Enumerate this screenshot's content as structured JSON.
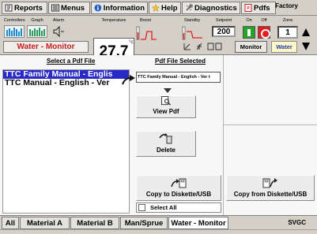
{
  "menu": {
    "items": [
      {
        "label": "Reports",
        "icon": "reports-icon"
      },
      {
        "label": "Menus",
        "icon": "menus-icon"
      },
      {
        "label": "Information",
        "icon": "information-icon"
      },
      {
        "label": "Help",
        "icon": "help-icon"
      },
      {
        "label": "Diagnostics",
        "icon": "diagnostics-icon"
      },
      {
        "label": "Pdfs",
        "icon": "pdf-icon"
      }
    ],
    "user_level": "Factory"
  },
  "controls": {
    "labels": {
      "controllers": "Controllers",
      "graph": "Graph",
      "alarm": "Alarm",
      "temperature": "Temperature",
      "boost": "Boost",
      "standby": "Standby",
      "setpoint": "Setpoint",
      "on": "On",
      "off": "Off",
      "zone": "Zone"
    },
    "temperature": "27.7",
    "temperature_unit": "°c",
    "setpoint": "200",
    "zone": "1",
    "mode": "Water - Monitor",
    "monitor_button": "Monitor",
    "water_button": "Water",
    "colors": {
      "on": "#27a32a",
      "off": "#e51d1d",
      "mode_text": "#c81e1e",
      "selection": "#2929c8"
    }
  },
  "pdf": {
    "select_title": "Select a Pdf File",
    "selected_title": "Pdf File Selected",
    "files": [
      {
        "name": "TTC Family Manual - Englis",
        "selected": true
      },
      {
        "name": "TTC Manual - English - Ver",
        "selected": false
      }
    ],
    "selected_file": "TTC Family Manual - English - Ver t",
    "actions": {
      "view": "View Pdf",
      "delete": "Delete",
      "copy_to": "Copy to Diskette/USB",
      "copy_from": "Copy from Diskette/USB"
    },
    "select_all": "Select All"
  },
  "tabs": {
    "items": [
      {
        "label": "All",
        "active": false
      },
      {
        "label": "Material A",
        "active": false
      },
      {
        "label": "Material B",
        "active": false
      },
      {
        "label": "Man/Sprue",
        "active": false
      },
      {
        "label": "Water - Monitor",
        "active": true
      }
    ],
    "status": "SVGC"
  }
}
